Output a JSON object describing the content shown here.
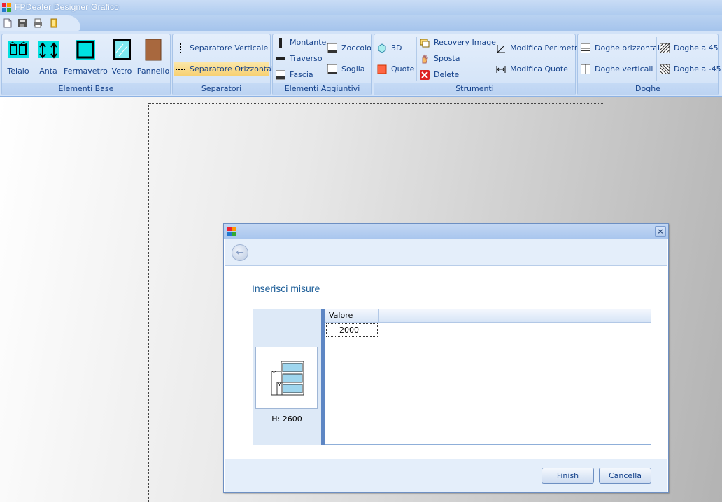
{
  "app": {
    "title": "FPDealer Designer Grafico"
  },
  "ribbon": {
    "elementi_base": {
      "label": "Elementi Base",
      "items": [
        "Telaio",
        "Anta",
        "Fermavetro",
        "Vetro",
        "Pannello"
      ]
    },
    "separatori": {
      "label": "Separatori",
      "items": [
        "Separatore Verticale",
        "Separatore Orizzontale"
      ]
    },
    "elementi_aggiuntivi": {
      "label": "Elementi Aggiuntivi",
      "items": [
        "Montante",
        "Traverso",
        "Fascia",
        "Zoccolo",
        "Soglia"
      ]
    },
    "strumenti": {
      "label": "Strumenti",
      "items": [
        "3D",
        "Quote",
        "Recovery Image",
        "Sposta",
        "Delete",
        "Modifica Perimetro",
        "Modifica Quote"
      ]
    },
    "doghe": {
      "label": "Doghe",
      "items": [
        "Doghe orizzontali",
        "Doghe verticali",
        "Doghe a 45",
        "Doghe a -45"
      ]
    }
  },
  "dialog": {
    "heading": "Inserisci misure",
    "preview_label": "H: 2600",
    "grid": {
      "columns": [
        "Valore"
      ],
      "rows": [
        [
          "2000"
        ]
      ]
    },
    "buttons": {
      "finish": "Finish",
      "cancel": "Cancella"
    },
    "close": "×",
    "back": "←"
  },
  "colors": {
    "accent": "#15428b",
    "ribbon_bg": "#d3e3f8",
    "selected": "#f7cf6f"
  }
}
